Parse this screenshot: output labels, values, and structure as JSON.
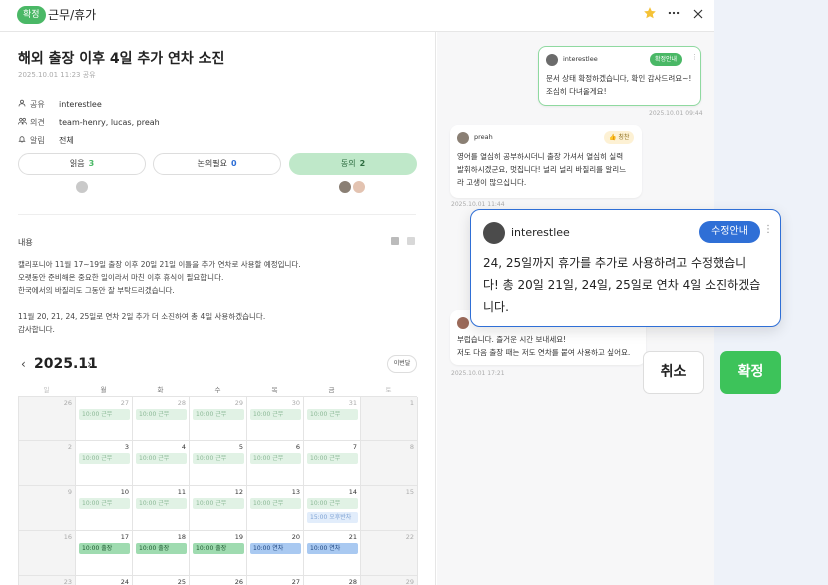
{
  "topbar": {
    "badge": "확정",
    "title": "근무/휴가",
    "star_icon": "star-icon",
    "more_icon": "more-icon",
    "close_icon": "close-icon"
  },
  "doc": {
    "title": "해외 출장 이후 4일 추가 연차 소진",
    "date": "2025.10.01 11:23 공유",
    "meta": [
      {
        "icon": "person-icon",
        "label": "공유",
        "value": "interestlee"
      },
      {
        "icon": "people-icon",
        "label": "의견",
        "value": "team-henry, lucas, preah"
      },
      {
        "icon": "bell-icon",
        "label": "알림",
        "value": "전체"
      }
    ],
    "votes": [
      {
        "label": "읽음",
        "count": "3",
        "color": "#4ab866"
      },
      {
        "label": "논의필요",
        "count": "0",
        "color": "#2f6fd6"
      },
      {
        "label": "동의",
        "count": "2",
        "color": "#2d6c40"
      }
    ],
    "section_label": "내용",
    "body": [
      "캘리포니아 11월 17~19일 출장 이후 20일 21일 이틀을 추가 연차로 사용할 예정입니다.",
      "오랫동안 준비해온 중요한 일이라서 마친 이후 휴식이 필요합니다.",
      "한국에서의 바질리도 그동안 잘 부탁드리겠습니다.",
      "",
      "11월 20, 21, 24, 25일로 연차 2일 추가 더 소진하여 총 4일 사용하겠습니다.",
      "감사합니다."
    ]
  },
  "calendar": {
    "title": "2025.11",
    "prev": "‹",
    "next": "›",
    "month_button": "이번달",
    "weekdays": [
      "일",
      "월",
      "화",
      "수",
      "목",
      "금",
      "토"
    ],
    "weeks": [
      {
        "days": [
          "26",
          "27",
          "28",
          "29",
          "30",
          "31",
          "1"
        ],
        "events": [
          [],
          [
            "10:00 근무"
          ],
          [
            "10:00 근무"
          ],
          [
            "10:00 근무"
          ],
          [
            "10:00 근무"
          ],
          [
            "10:00 근무"
          ],
          []
        ]
      },
      {
        "days": [
          "2",
          "3",
          "4",
          "5",
          "6",
          "7",
          "8"
        ],
        "events": [
          [],
          [
            "10:00 근무"
          ],
          [
            "10:00 근무"
          ],
          [
            "10:00 근무"
          ],
          [
            "10:00 근무"
          ],
          [
            "10:00 근무"
          ],
          []
        ]
      },
      {
        "days": [
          "9",
          "10",
          "11",
          "12",
          "13",
          "14",
          "15"
        ],
        "events": [
          [],
          [
            "10:00 근무"
          ],
          [
            "10:00 근무"
          ],
          [
            "10:00 근무"
          ],
          [
            "10:00 근무"
          ],
          [
            "10:00 근무",
            "15:00 오후반차"
          ],
          []
        ]
      },
      {
        "days": [
          "16",
          "17",
          "18",
          "19",
          "20",
          "21",
          "22"
        ],
        "events": [
          [],
          [
            "10:00 출장"
          ],
          [
            "10:00 출장"
          ],
          [
            "10:00 출장"
          ],
          [
            "10:00 연차"
          ],
          [
            "10:00 연차"
          ],
          []
        ]
      },
      {
        "days": [
          "23",
          "24",
          "25",
          "26",
          "27",
          "28",
          "29"
        ],
        "events": [
          [],
          [],
          [],
          [],
          [],
          [],
          []
        ]
      }
    ]
  },
  "messages": [
    {
      "user": "interestlee",
      "badge": "확정안내",
      "lines": [
        "문서 상태 확정하겠습니다, 확인 감사드려요~!",
        "조심히 다녀올게요!"
      ],
      "time": "2025.10.01 09:44"
    },
    {
      "user": "preah",
      "badge": "👍 칭찬",
      "lines": [
        "영어를 열심히 공부하시더니 출장 가셔서 열심히 실력",
        "발휘하시겠군요, 멋집니다! 널리 널리 바질리를 알리느",
        "라 고생이 많으십니다."
      ],
      "time": "2025.10.01 11:44"
    },
    {
      "user": "",
      "badge": "",
      "lines": [
        "부럽습니다. 즐거운 시간 보내세요!",
        "저도 다음 출장 때는 저도 연차를 붙여 사용하고 싶어요."
      ],
      "time": "2025.10.01 17:21"
    }
  ],
  "popup": {
    "user": "interestlee",
    "badge": "수정안내",
    "lines": [
      "24, 25일까지 휴가를 추가로 사용하려고 수정했습니",
      "다! 총 20일 21일, 24일, 25일로 연차 4일 소진하겠습",
      "니다."
    ]
  },
  "actions": {
    "cancel": "취소",
    "confirm": "확정"
  },
  "colors": {
    "accent_green": "#3dc35a",
    "accent_blue": "#2f6fd6",
    "agree_bg": "#bfe8c9"
  }
}
